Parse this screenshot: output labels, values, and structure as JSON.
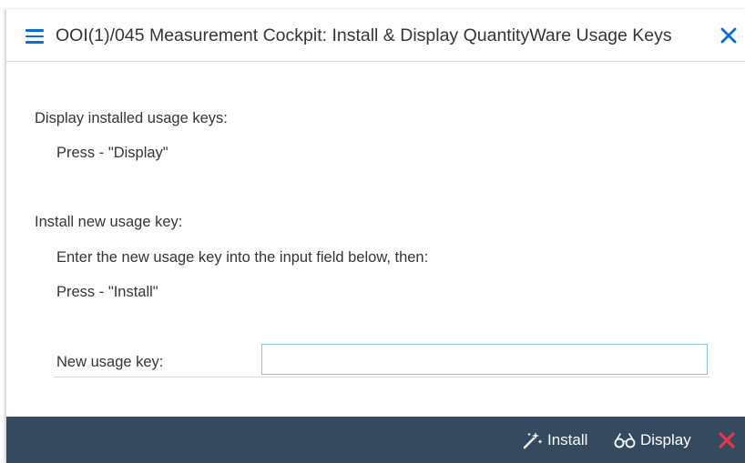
{
  "dialog": {
    "title": "OOI(1)/045 Measurement Cockpit: Install & Display QuantityWare Usage Keys"
  },
  "content": {
    "display_heading": "Display installed usage keys:",
    "display_instruction": "Press - \"Display\"",
    "install_heading": "Install new usage key:",
    "install_instruction_1": "Enter the new usage key into the input field below, then:",
    "install_instruction_2": "Press - \"Install\"",
    "field_label": "New usage key:",
    "field_value": ""
  },
  "footer": {
    "install_label": "Install",
    "display_label": "Display"
  },
  "icons": {
    "menu": "hamburger-menu-icon",
    "close": "close-icon",
    "install": "magic-wand-icon",
    "display": "glasses-icon",
    "cancel": "cancel-icon"
  },
  "colors": {
    "accent": "#0a6ed1",
    "footer_bg": "#354a5f",
    "cancel_red": "#e9344d",
    "input_border": "#89bde6"
  }
}
